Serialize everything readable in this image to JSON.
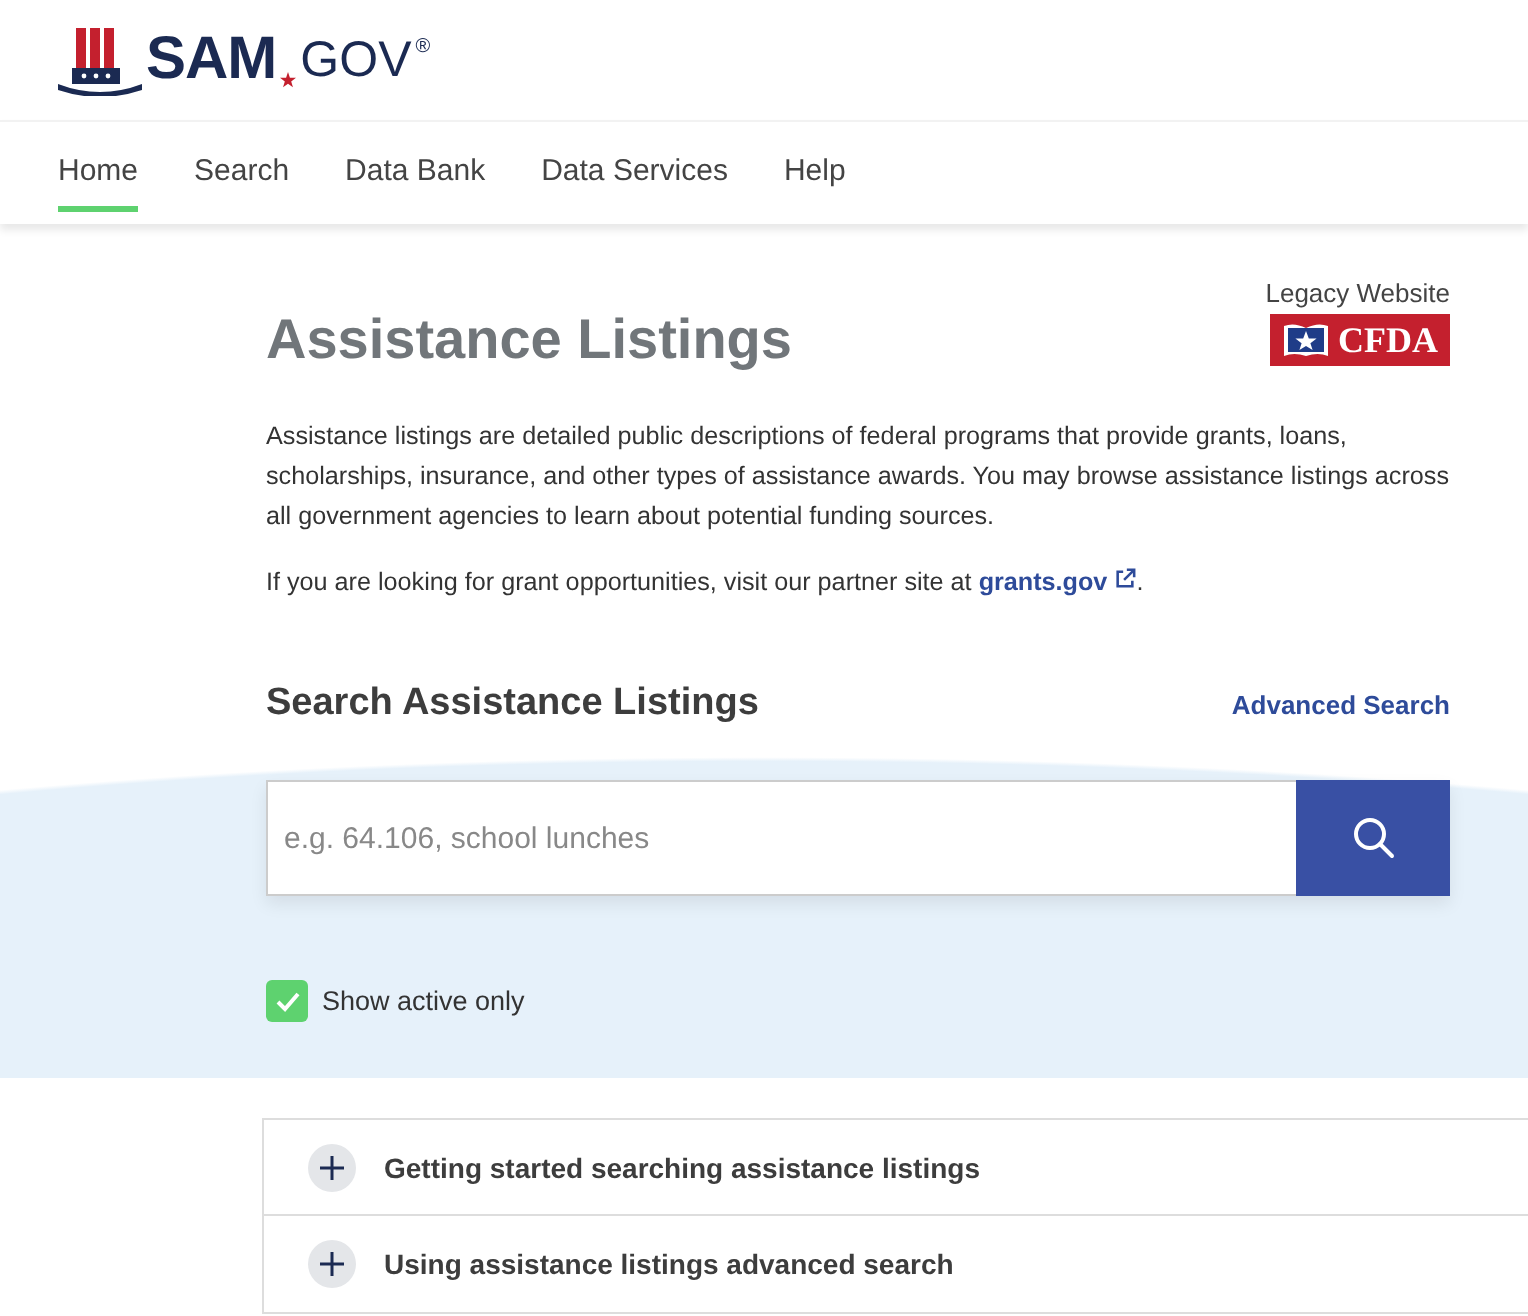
{
  "logo": {
    "name": "SAM",
    "suffix": "GOV",
    "mark": "®"
  },
  "nav": [
    {
      "label": "Home",
      "selected": true
    },
    {
      "label": "Search",
      "selected": false
    },
    {
      "label": "Data Bank",
      "selected": false
    },
    {
      "label": "Data Services",
      "selected": false
    },
    {
      "label": "Help",
      "selected": false
    }
  ],
  "title": "Assistance Listings",
  "legacy": {
    "label": "Legacy Website",
    "badge": "CFDA"
  },
  "description": "Assistance listings are detailed public descriptions of federal programs that provide grants, loans, scholarships, insurance, and other types of assistance awards. You may browse assistance listings across all government agencies to learn about potential funding sources.",
  "partner": {
    "text": "If you are looking for grant opportunities, visit our partner site at",
    "link": "grants.gov",
    "end": "."
  },
  "search": {
    "heading": "Search Assistance Listings",
    "advanced": "Advanced Search",
    "placeholder": "e.g. 64.106, school lunches"
  },
  "filter": {
    "label": "Show active only",
    "checked": true
  },
  "accordion": [
    {
      "label": "Getting started searching assistance listings",
      "expanded": false
    },
    {
      "label": "Using assistance listings advanced search",
      "expanded": false
    }
  ]
}
